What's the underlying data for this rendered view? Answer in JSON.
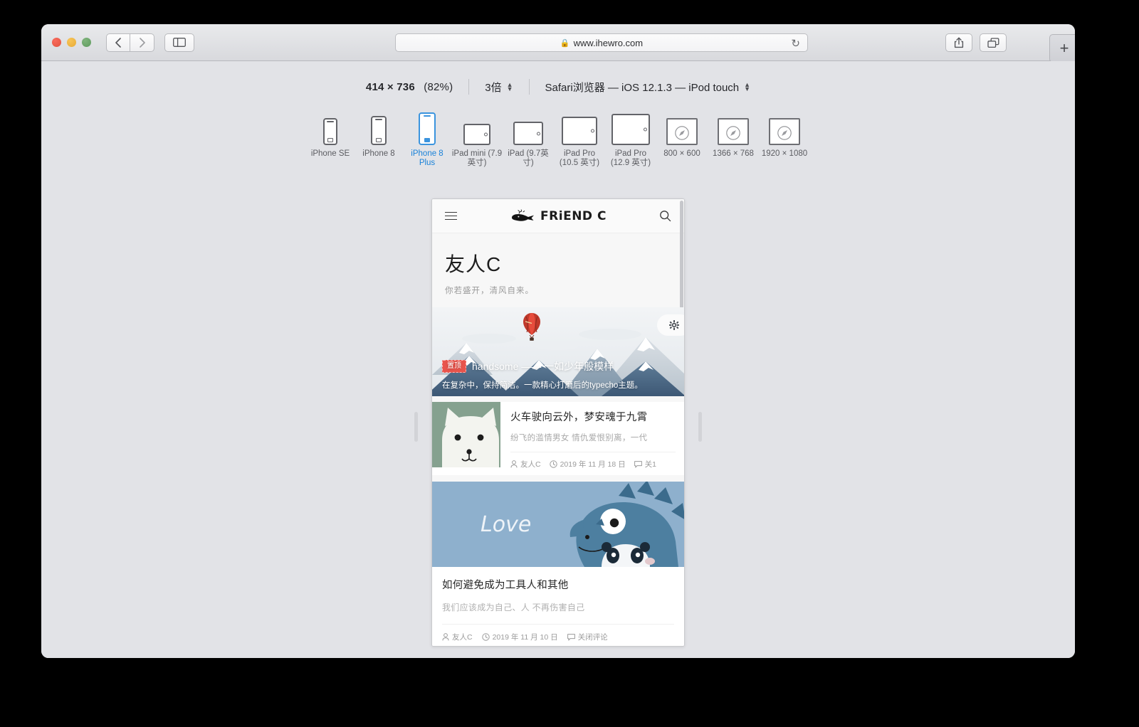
{
  "browser": {
    "url": "www.ihewro.com",
    "lock_icon": "lock-icon",
    "back_icon": "chevron-left-icon",
    "forward_icon": "chevron-right-icon",
    "sidebar_icon": "sidebar-icon",
    "reload_icon": "reload-icon",
    "share_icon": "share-icon",
    "tabs_icon": "duplicate-tabs-icon",
    "new_tab_label": "+"
  },
  "responsive_bar": {
    "viewport_size": "414 × 736",
    "zoom_percent": "(82%)",
    "pixel_ratio": "3倍",
    "user_agent": "Safari浏览器 — iOS 12.1.3 — iPod touch",
    "devices": [
      {
        "label": "iPhone SE",
        "type": "phone",
        "selected": false
      },
      {
        "label": "iPhone 8",
        "type": "phone",
        "selected": false
      },
      {
        "label": "iPhone 8 Plus",
        "type": "phone",
        "selected": true
      },
      {
        "label": "iPad mini (7.9英寸)",
        "type": "tablet",
        "selected": false
      },
      {
        "label": "iPad (9.7英寸)",
        "type": "tablet",
        "selected": false
      },
      {
        "label": "iPad Pro (10.5 英寸)",
        "type": "tablet-pro",
        "selected": false
      },
      {
        "label": "iPad Pro (12.9 英寸)",
        "type": "tablet-pro",
        "selected": false
      },
      {
        "label": "800 × 600",
        "type": "desktop",
        "selected": false
      },
      {
        "label": "1366 × 768",
        "type": "desktop",
        "selected": false
      },
      {
        "label": "1920 × 1080",
        "type": "desktop",
        "selected": false
      }
    ]
  },
  "site": {
    "header": {
      "menu_icon": "hamburger-menu-icon",
      "logo_icon": "whale-logo-icon",
      "brand": "FRiEND C",
      "search_icon": "search-icon"
    },
    "title": "友人C",
    "subtitle": "你若盛开，清风自来。",
    "hero": {
      "badge": "置顶",
      "title": "handsome —— 一如少年般模样",
      "description": "在复杂中，保持简洁。一款精心打磨后的typecho主题。",
      "gear_icon": "gear-icon"
    },
    "posts": [
      {
        "title": "火车驶向云外，梦安魂于九霄",
        "excerpt": "纷飞的滥情男女 情仇爱恨别离，一代",
        "author_icon": "person-icon",
        "author": "友人C",
        "date_icon": "clock-icon",
        "date": "2019 年 11 月 18 日",
        "comment_icon": "comment-icon",
        "comments": "关1",
        "thumb_color": "#85a18f",
        "layout": "list"
      },
      {
        "title": "如何避免成为工具人和其他",
        "excerpt": "我们应该成为自己、人 不再伤害自己",
        "author_icon": "person-icon",
        "author": "友人C",
        "date_icon": "clock-icon",
        "date": "2019 年 11 月 10 日",
        "comment_icon": "comment-icon",
        "comments": "关闭评论",
        "cover_text": "Love",
        "cover_color": "#8eb0cd",
        "layout": "cover"
      }
    ]
  },
  "colors": {
    "window_bg": "#e2e3e7",
    "accent_blue": "#1a82d8",
    "badge_red": "#e8544c"
  }
}
